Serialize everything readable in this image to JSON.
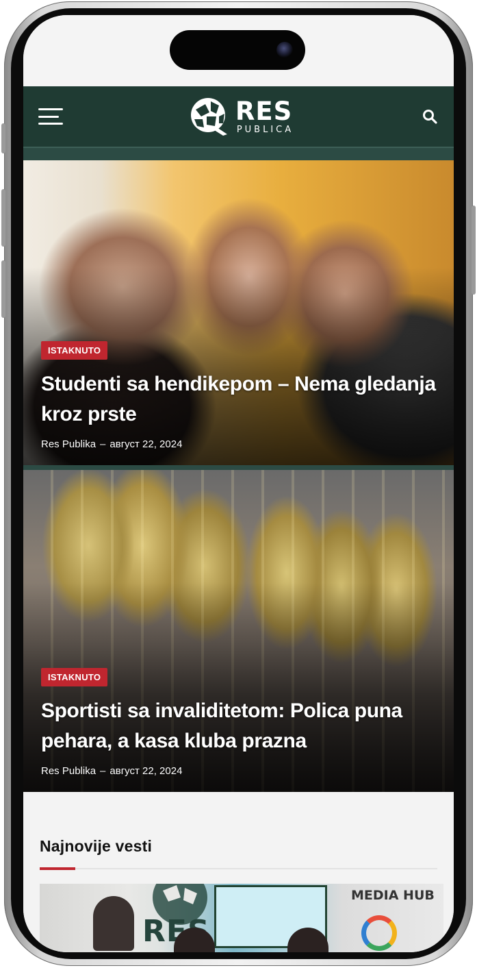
{
  "header": {
    "logo_main": "RES",
    "logo_sub": "PUBLICA"
  },
  "articles": [
    {
      "badge": "ISTAKNUTO",
      "title": "Studenti sa hendikepom – Nema gledanja kroz prste",
      "author": "Res Publika",
      "date": "август 22, 2024"
    },
    {
      "badge": "ISTAKNUTO",
      "title": "Sportisti sa invaliditetom: Polica puna pehara, a kasa kluba prazna",
      "author": "Res Publika",
      "date": "август 22, 2024"
    }
  ],
  "latest": {
    "heading": "Najnovije vesti",
    "image_sign": "MEDIA HUB",
    "image_logo": "RES"
  },
  "colors": {
    "header_bg": "#1f3b33",
    "badge_red": "#c0262f",
    "accent_red": "#c0262f"
  },
  "icons": {
    "menu": "hamburger-icon",
    "search": "search-icon",
    "logo": "res-publica-logo"
  }
}
